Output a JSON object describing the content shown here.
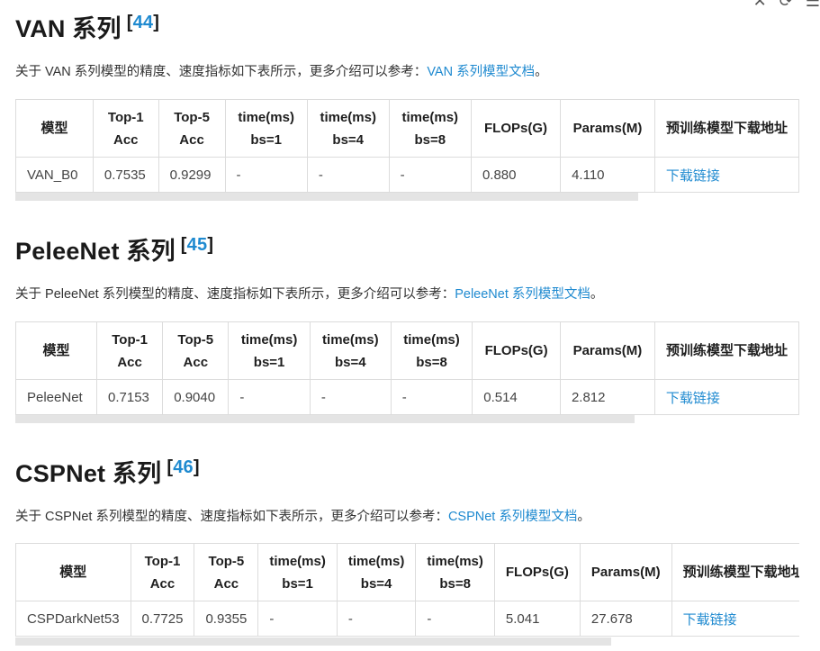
{
  "toolbar": {
    "close_icon": "✕",
    "refresh_icon": "⟳",
    "menu_icon": "☰"
  },
  "common": {
    "desc_prefix": "关于 ",
    "desc_mid": " 系列模型的精度、速度指标如下表所示，更多介绍可以参考：",
    "desc_suffix": "。",
    "headers": [
      "模型",
      "Top-1\nAcc",
      "Top-5\nAcc",
      "time(ms)\nbs=1",
      "time(ms)\nbs=4",
      "time(ms)\nbs=8",
      "FLOPs(G)",
      "Params(M)",
      "预训练模型下载地址"
    ]
  },
  "sections": [
    {
      "title": "VAN 系列",
      "ref": "44",
      "name": "VAN",
      "doc_link": "VAN 系列模型文档",
      "row": [
        "VAN_B0",
        "0.7535",
        "0.9299",
        "-",
        "-",
        "-",
        "0.880",
        "4.110",
        "下载链接"
      ]
    },
    {
      "title": "PeleeNet 系列",
      "ref": "45",
      "name": "PeleeNet",
      "doc_link": "PeleeNet 系列模型文档",
      "row": [
        "PeleeNet",
        "0.7153",
        "0.9040",
        "-",
        "-",
        "-",
        "0.514",
        "2.812",
        "下载链接"
      ]
    },
    {
      "title": "CSPNet 系列",
      "ref": "46",
      "name": "CSPNet",
      "doc_link": "CSPNet 系列模型文档",
      "row": [
        "CSPDarkNet53",
        "0.7725",
        "0.9355",
        "-",
        "-",
        "-",
        "5.041",
        "27.678",
        "下载链接"
      ]
    }
  ]
}
